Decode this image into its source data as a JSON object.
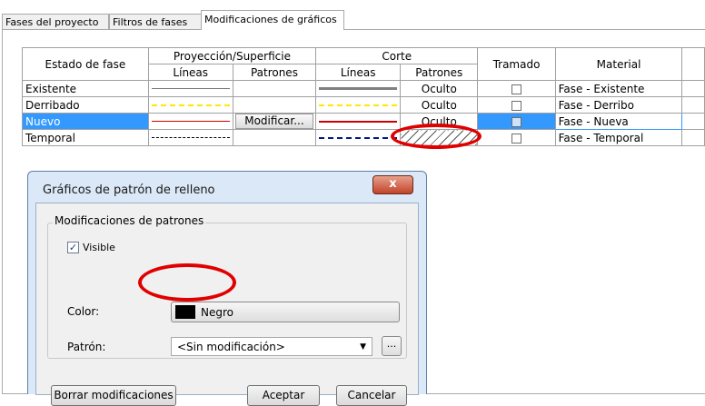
{
  "tabs": [
    {
      "label": "Fases del proyecto"
    },
    {
      "label": "Filtros de fases"
    },
    {
      "label": "Modificaciones de gráficos"
    }
  ],
  "table": {
    "headers": {
      "phase_state": "Estado de fase",
      "projection": "Proyección/Superficie",
      "cut": "Corte",
      "lines": "Líneas",
      "patterns": "Patrones",
      "halftone": "Tramado",
      "material": "Material"
    },
    "rows": [
      {
        "name": "Existente",
        "cut_pattern": "Oculto",
        "material": "Fase - Existente",
        "halftone": false
      },
      {
        "name": "Derribado",
        "cut_pattern": "Oculto",
        "material": "Fase - Derribo",
        "halftone": false
      },
      {
        "name": "Nuevo",
        "proj_pattern": "Modificar...",
        "cut_pattern": "Oculto",
        "material": "Fase - Nueva",
        "halftone": false
      },
      {
        "name": "Temporal",
        "material": "Fase - Temporal",
        "halftone": false
      }
    ]
  },
  "dialog": {
    "title": "Gráficos de patrón de relleno",
    "close": "x",
    "group_label": "Modificaciones de patrones",
    "visible_label": "Visible",
    "visible_checked": true,
    "color_label": "Color:",
    "color_value": "Negro",
    "color_hex": "#000000",
    "pattern_label": "Patrón:",
    "pattern_value": "<Sin modificación>",
    "ellipsis": "...",
    "clear_button": "Borrar modificaciones",
    "ok_button": "Aceptar",
    "cancel_button": "Cancelar"
  },
  "colors": {
    "selection": "#3399ff",
    "highlight": "#e00000",
    "demolished_line": "#ffe800",
    "new_line": "#d00000",
    "temporary_line": "#001a80"
  }
}
